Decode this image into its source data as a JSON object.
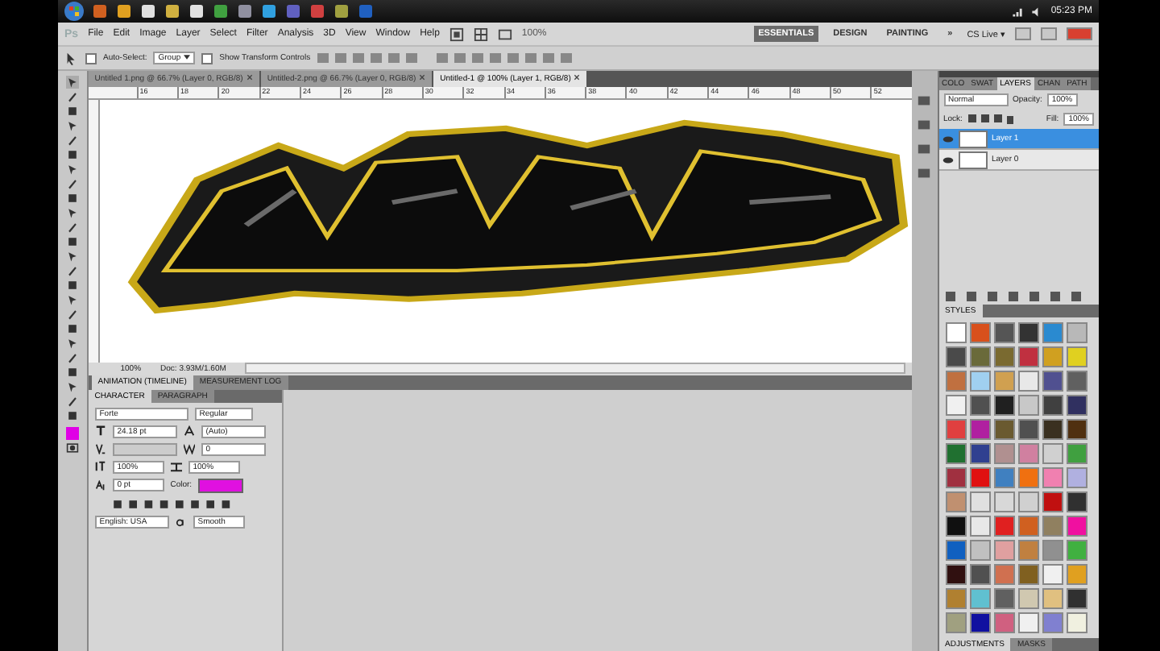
{
  "taskbar": {
    "clock": "05:23 PM"
  },
  "menu": {
    "logo": "Ps",
    "items": [
      "File",
      "Edit",
      "Image",
      "Layer",
      "Select",
      "Filter",
      "Analysis",
      "3D",
      "View",
      "Window",
      "Help"
    ],
    "zoom": "100%"
  },
  "workspaces": {
    "items": [
      {
        "label": "ESSENTIALS",
        "selected": true
      },
      {
        "label": "DESIGN",
        "selected": false
      },
      {
        "label": "PAINTING",
        "selected": false
      }
    ],
    "more": "»",
    "cs_live": "CS Live ▾"
  },
  "options_bar": {
    "auto_select": {
      "label": "Auto-Select:",
      "checked": false
    },
    "group": "Group",
    "transform": {
      "label": "Show Transform Controls",
      "checked": false
    }
  },
  "doc_tabs": [
    {
      "label": "Untitled 1.png @ 66.7% (Layer 0, RGB/8)",
      "selected": false
    },
    {
      "label": "Untitled-2.png @ 66.7% (Layer 0, RGB/8)",
      "selected": false
    },
    {
      "label": "Untitled-1 @ 100% (Layer 1, RGB/8)",
      "selected": true
    }
  ],
  "ruler": [
    "16",
    "18",
    "20",
    "22",
    "24",
    "26",
    "28",
    "30",
    "32",
    "34",
    "36",
    "38",
    "40",
    "42",
    "44",
    "46",
    "48",
    "50",
    "52"
  ],
  "status_bar": {
    "zoom": "100%",
    "doc": "Doc: 3.93M/1.60M"
  },
  "bottom_tabs": [
    {
      "label": "ANIMATION (TIMELINE)",
      "selected": true
    },
    {
      "label": "MEASUREMENT LOG",
      "selected": false
    }
  ],
  "character": {
    "tabs": [
      {
        "label": "CHARACTER",
        "selected": true
      },
      {
        "label": "PARAGRAPH",
        "selected": false
      }
    ],
    "font": "Forte",
    "style": "Regular",
    "size": "24.18 pt",
    "leading": "(Auto)",
    "tracking": "0",
    "vertical_scale": "100%",
    "horizontal_scale": "100%",
    "baseline": "0 pt",
    "color_label": "Color:",
    "language": "English: USA",
    "antialias": "Smooth"
  },
  "layers_panel": {
    "tabs": [
      {
        "label": "COLO",
        "selected": false
      },
      {
        "label": "SWAT",
        "selected": false
      },
      {
        "label": "LAYERS",
        "selected": true
      },
      {
        "label": "CHAN",
        "selected": false
      },
      {
        "label": "PATH",
        "selected": false
      }
    ],
    "blend": "Normal",
    "opacity_label": "Opacity:",
    "opacity": "100%",
    "lock_label": "Lock:",
    "fill_label": "Fill:",
    "fill": "100%",
    "layers": [
      {
        "name": "Layer 1",
        "selected": true
      },
      {
        "name": "Layer 0",
        "selected": false
      }
    ]
  },
  "styles_panel": {
    "title": "STYLES",
    "swatches": [
      {
        "color": "#ffffff"
      },
      {
        "color": "#d8501c"
      },
      {
        "color": "#555555"
      },
      {
        "color": "#333333"
      },
      {
        "color": "#2a8ad0"
      },
      {
        "color": "#b8b8b8"
      },
      {
        "color": "#4a4a4a"
      },
      {
        "color": "#6a6a3a"
      },
      {
        "color": "#7a6a30"
      },
      {
        "color": "#c03040"
      },
      {
        "color": "#d0a020"
      },
      {
        "color": "#e0d020"
      },
      {
        "color": "#c07040"
      },
      {
        "color": "#a0d0f0"
      },
      {
        "color": "#d0a050"
      },
      {
        "color": "#e8e8e8"
      },
      {
        "color": "#505090"
      },
      {
        "color": "#606060"
      },
      {
        "color": "#f0f0f0"
      },
      {
        "color": "#505050"
      },
      {
        "color": "#202020"
      },
      {
        "color": "#c8c8c8"
      },
      {
        "color": "#404040"
      },
      {
        "color": "#303060"
      },
      {
        "color": "#e04040"
      },
      {
        "color": "#b020a0"
      },
      {
        "color": "#6a5a30"
      },
      {
        "color": "#505050"
      },
      {
        "color": "#3a3020"
      },
      {
        "color": "#503010"
      },
      {
        "color": "#207030"
      },
      {
        "color": "#304090"
      },
      {
        "color": "#b09090"
      },
      {
        "color": "#d080a0"
      },
      {
        "color": "#d0d0d0"
      },
      {
        "color": "#40a040"
      },
      {
        "color": "#a03040"
      },
      {
        "color": "#e01010"
      },
      {
        "color": "#4080c0"
      },
      {
        "color": "#f07010"
      },
      {
        "color": "#f080b0"
      },
      {
        "color": "#b0b0e0"
      },
      {
        "color": "#c09070"
      },
      {
        "color": "#e0e0e0"
      },
      {
        "color": "#d8d8d8"
      },
      {
        "color": "#d0d0d0"
      },
      {
        "color": "#c01010"
      },
      {
        "color": "#303030"
      },
      {
        "color": "#101010"
      },
      {
        "color": "#e8e8e8"
      },
      {
        "color": "#e02020"
      },
      {
        "color": "#d06020"
      },
      {
        "color": "#908060"
      },
      {
        "color": "#f010a0"
      },
      {
        "color": "#1060c0"
      },
      {
        "color": "#c0c0c0"
      },
      {
        "color": "#e0a0a0"
      },
      {
        "color": "#c08040"
      },
      {
        "color": "#909090"
      },
      {
        "color": "#40b040"
      },
      {
        "color": "#301010"
      },
      {
        "color": "#505050"
      },
      {
        "color": "#d07050"
      },
      {
        "color": "#806020"
      },
      {
        "color": "#f0f0f0"
      },
      {
        "color": "#e0a020"
      },
      {
        "color": "#b08030"
      },
      {
        "color": "#60c0d0"
      },
      {
        "color": "#606060"
      },
      {
        "color": "#d0c8b0"
      },
      {
        "color": "#e0c080"
      },
      {
        "color": "#303030"
      },
      {
        "color": "#a0a080"
      },
      {
        "color": "#1010a0"
      },
      {
        "color": "#d06080"
      },
      {
        "color": "#f0f0f0"
      },
      {
        "color": "#8080d0"
      },
      {
        "color": "#f0f0e0"
      }
    ]
  },
  "bottom_right_tabs": [
    {
      "label": "ADJUSTMENTS",
      "selected": true
    },
    {
      "label": "MASKS",
      "selected": false
    }
  ]
}
